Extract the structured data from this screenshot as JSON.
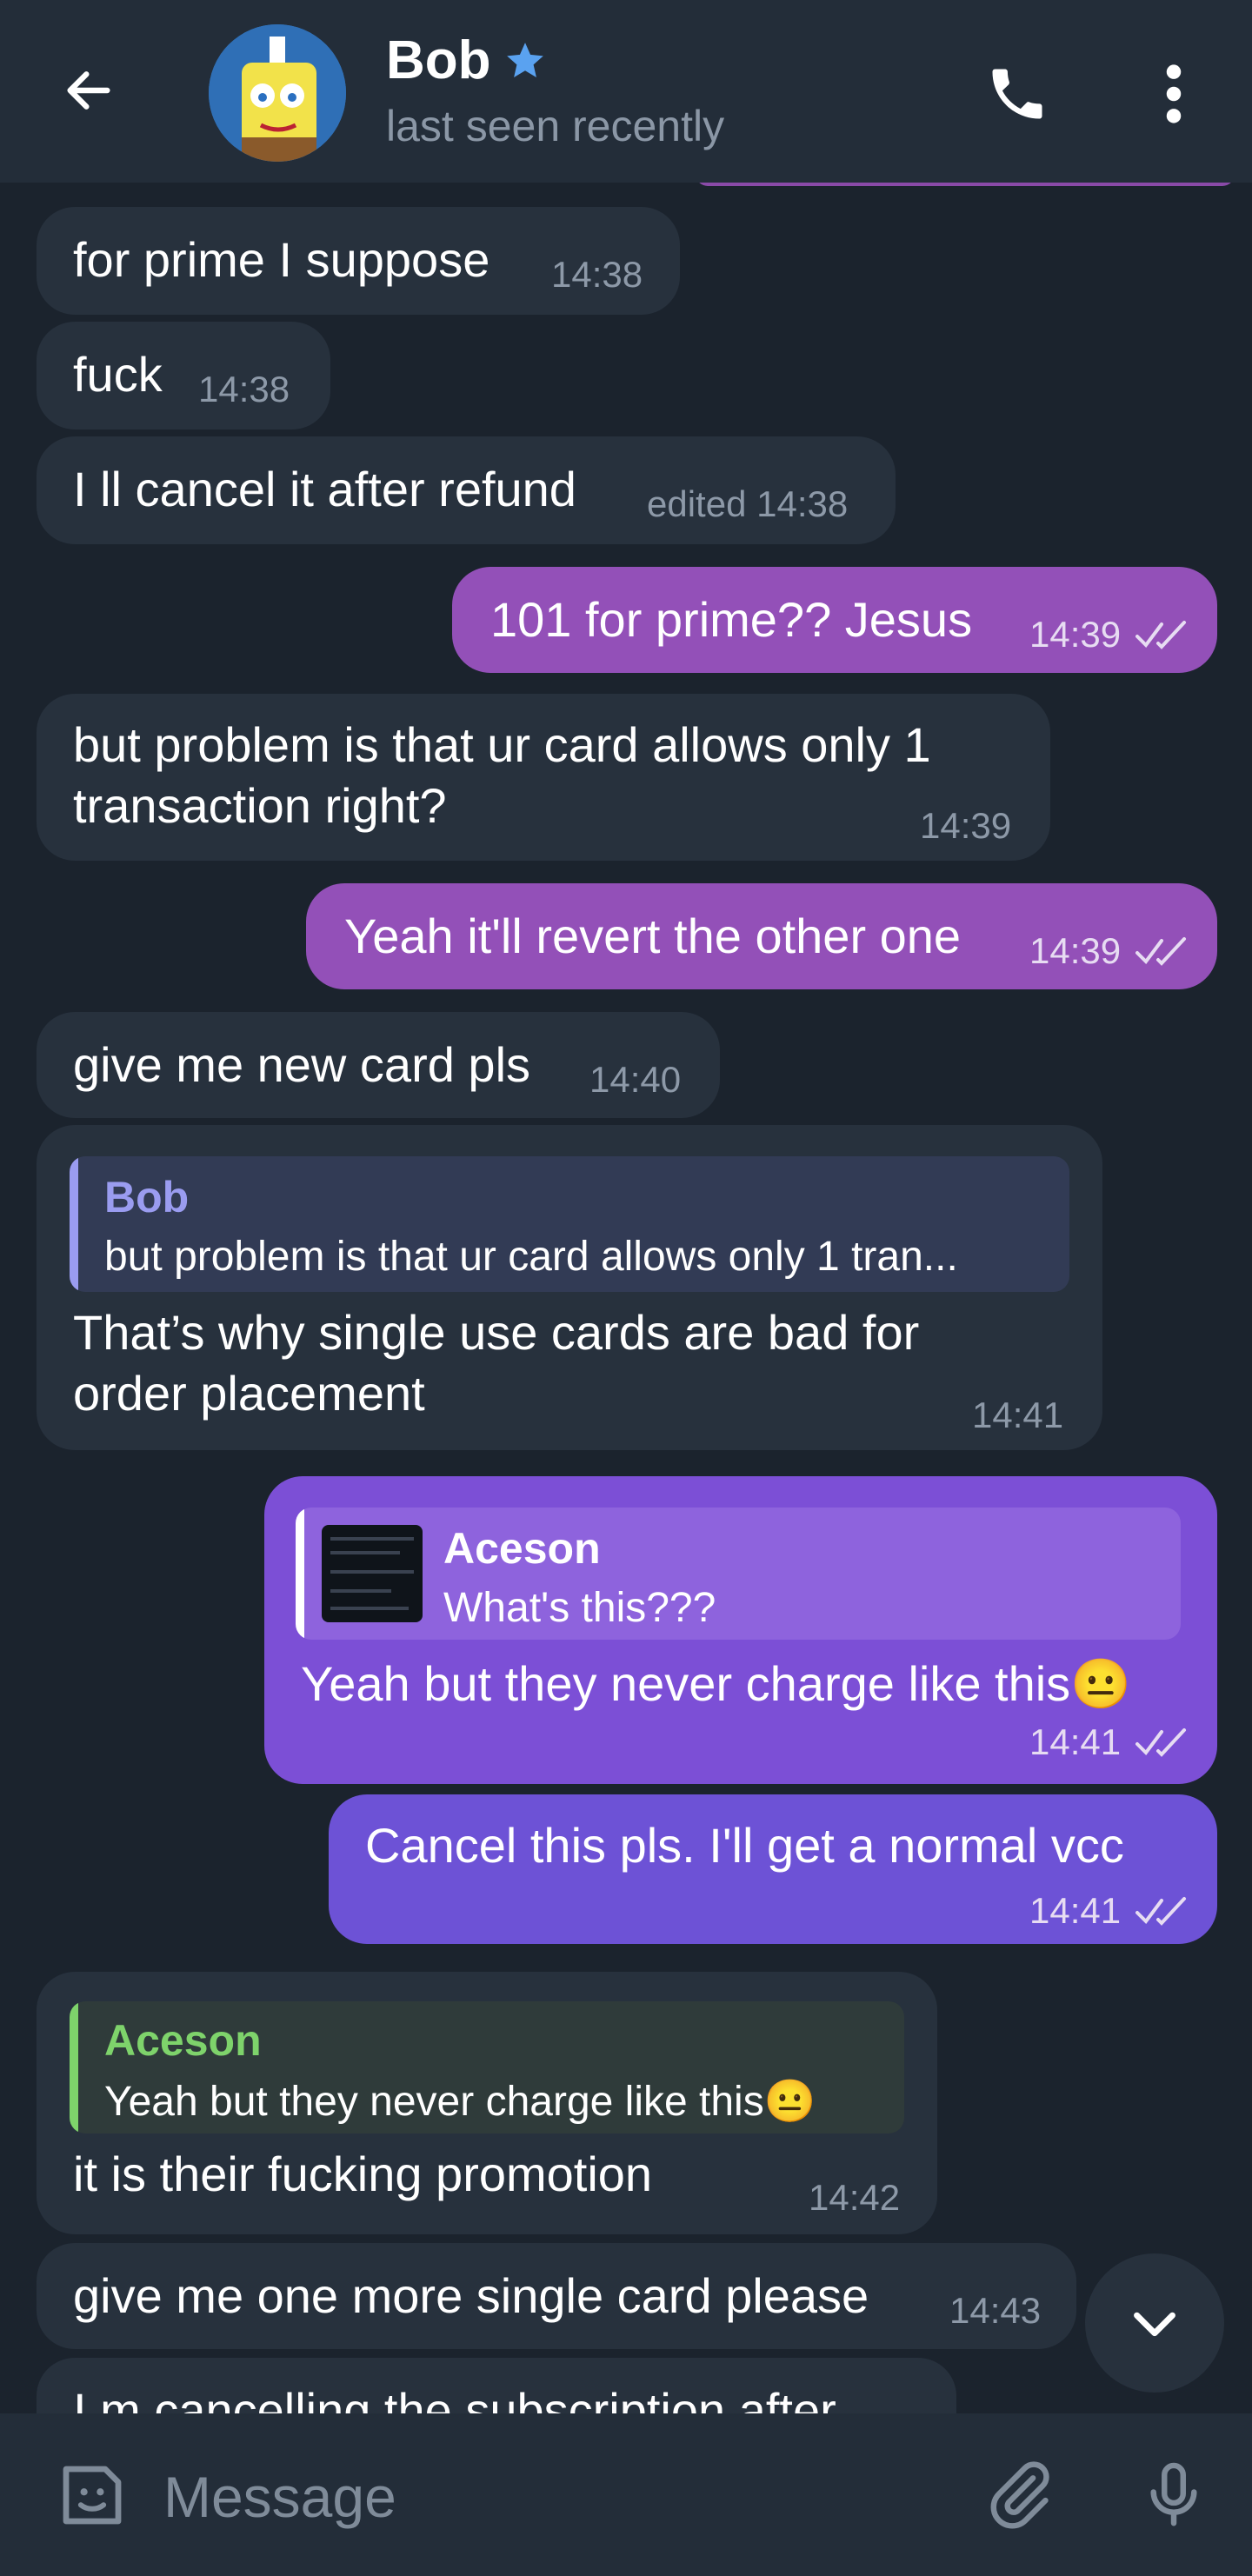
{
  "header": {
    "name": "Bob",
    "status": "last seen recently",
    "back_icon": "back-arrow-icon",
    "call_icon": "phone-icon",
    "more_icon": "more-vertical-icon",
    "star_icon": "premium-star-icon"
  },
  "messages": [
    {
      "dir": "in",
      "text": "for prime I suppose",
      "time": "14:38"
    },
    {
      "dir": "in",
      "text": "fuck",
      "time": "14:38"
    },
    {
      "dir": "in",
      "text": "I ll cancel it after refund",
      "time": "edited 14:38"
    },
    {
      "dir": "out",
      "text": "101 for prime?? Jesus",
      "time": "14:39"
    },
    {
      "dir": "in",
      "text_line1": "but problem is that ur card allows only 1",
      "text_line2": "transaction right?",
      "time": "14:39"
    },
    {
      "dir": "out",
      "text": "Yeah it'll revert the other one",
      "time": "14:39"
    },
    {
      "dir": "in",
      "text": "give me new card pls",
      "time": "14:40"
    },
    {
      "dir": "in",
      "reply_name": "Bob",
      "reply_text": "but problem is that ur card allows only 1 tran...",
      "text_line1": "That’s why single use cards are bad for",
      "text_line2": "order placement",
      "time": "14:41"
    },
    {
      "dir": "out",
      "reply_name": "Aceson",
      "reply_text": "What's this???",
      "text": "Yeah but they never charge like this😐",
      "time": "14:41"
    },
    {
      "dir": "out",
      "text": "Cancel this pls. I'll get a normal vcc",
      "time": "14:41"
    },
    {
      "dir": "in",
      "reply_name": "Aceson",
      "reply_text": "Yeah but they never charge like this😐",
      "text": "it is their fucking promotion",
      "time": "14:42"
    },
    {
      "dir": "in",
      "text": "give me one more single card please",
      "time": "14:43"
    },
    {
      "dir": "in",
      "text": "I m cancelling the subscription after"
    }
  ],
  "composer": {
    "placeholder": "Message",
    "emoji_icon": "sticker-emoji-icon",
    "attach_icon": "paperclip-icon",
    "mic_icon": "microphone-icon"
  },
  "scroll_down_icon": "chevron-down-icon",
  "colors": {
    "background": "#1b232d",
    "incoming": "#27313d",
    "outgoing": "#9350b8",
    "outgoing_alt": "#7c4fd6",
    "accent_blue": "#5aa2f0",
    "reply_name_purple": "#9a9cf0",
    "reply_name_green": "#7ed36b"
  }
}
